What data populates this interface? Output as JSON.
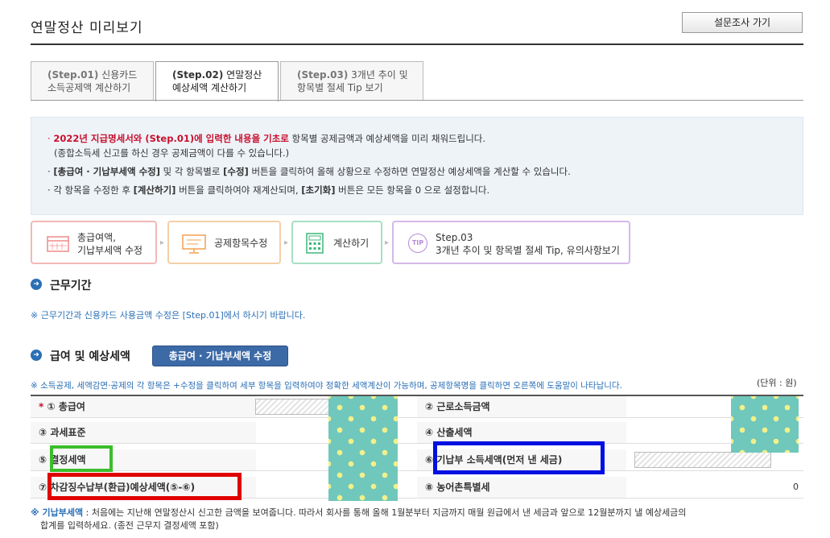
{
  "header": {
    "title": "연말정산 미리보기",
    "survey_label": "설문조사 가기"
  },
  "tabs": [
    {
      "step": "(Step.01)",
      "line1": "신용카드",
      "line2": "소득공제액 계산하기"
    },
    {
      "step": "(Step.02)",
      "line1": "연말정산",
      "line2": "예상세액 계산하기"
    },
    {
      "step": "(Step.03)",
      "line1": "3개년 추이 및",
      "line2": "항목별 절세 Tip 보기"
    }
  ],
  "notice": {
    "l1_red": "2022년 지급명세서와 (Step.01)에 입력한 내용을 기초로",
    "l1_rest": " 항목별 공제금액과 예상세액을 미리 채워드립니다.",
    "l2": "(종합소득세 신고를 하신 경우 공제금액이 다를 수 있습니다.)",
    "l3_a": "[총급여 · 기납부세액 수정]",
    "l3_b": " 및 각 항목별로 ",
    "l3_c": "[수정]",
    "l3_d": " 버튼을 클릭하여 올해 상황으로 수정하면 연말정산 예상세액을 계산할 수 있습니다.",
    "l4_a": "각 항목을 수정한 후 ",
    "l4_b": "[계산하기]",
    "l4_c": " 버튼을 클릭하여야 재계산되며, ",
    "l4_d": "[초기화]",
    "l4_e": " 버튼은 모든 항목을 0 으로 설정합니다."
  },
  "steps": {
    "s1_line1": "총급여액,",
    "s1_line2": "기납부세액 수정",
    "s2": "공제항목수정",
    "s3": "계산하기",
    "s4_line1": "Step.03",
    "s4_line2": "3개년 추이 및 항목별 절세 Tip, 유의사항보기",
    "tip_badge": "TIP",
    "bullet": "·"
  },
  "sections": {
    "work_title": "근무기간",
    "work_info": "※ 근무기간과 신용카드 사용금액 수정은 [Step.01]에서 하시기 바랍니다.",
    "pay_title": "급여 및 예상세액",
    "pay_edit_button": "총급여 · 기납부세액 수정",
    "pay_info": "※ 소득공제, 세액감면·공제의 각 항목은 +수정을 클릭하여 세부 항목을 입력하여야 정확한 세액계산이 가능하며, 공제항목명을 클릭하면 오른쪽에 도움말이 나타납니다.",
    "unit": "(단위 : 원)"
  },
  "table": {
    "required_mark": "*",
    "r1_left": "① 총급여",
    "r1_right": "② 근로소득금액",
    "r2_left": "③ 과세표준",
    "r2_right": "④ 산출세액",
    "r3_left": "⑤ 결정세액",
    "r3_right": "⑥ 기납부 소득세액(먼저 낸 세금)",
    "r4_left": "⑦ 차감징수납부(환급)예상세액(⑤-⑥)",
    "r4_right": "⑧ 농어촌특별세",
    "r4_right_value": "0"
  },
  "footer": {
    "label": "※ 기납부세액",
    "text": " : 처음에는 지난해 연말정산시 신고한 금액을 보여줍니다. 따라서 회사를 통해 올해 1월분부터 지금까지 매월 원급에서 낸 세금과 앞으로 12월분까지 낼 예상세금의",
    "text2": "합계를 입력하세요. (종전 근무지 결정세액 포함)"
  },
  "colors": {
    "accent_blue": "#2a6fb5",
    "emphasis_red": "#c8102e",
    "highlight_green": "#3cbd2b",
    "highlight_red": "#e00000",
    "highlight_blue": "#0010e0",
    "polka_bg": "#70c7bb",
    "polka_dot": "#f1f08a"
  }
}
